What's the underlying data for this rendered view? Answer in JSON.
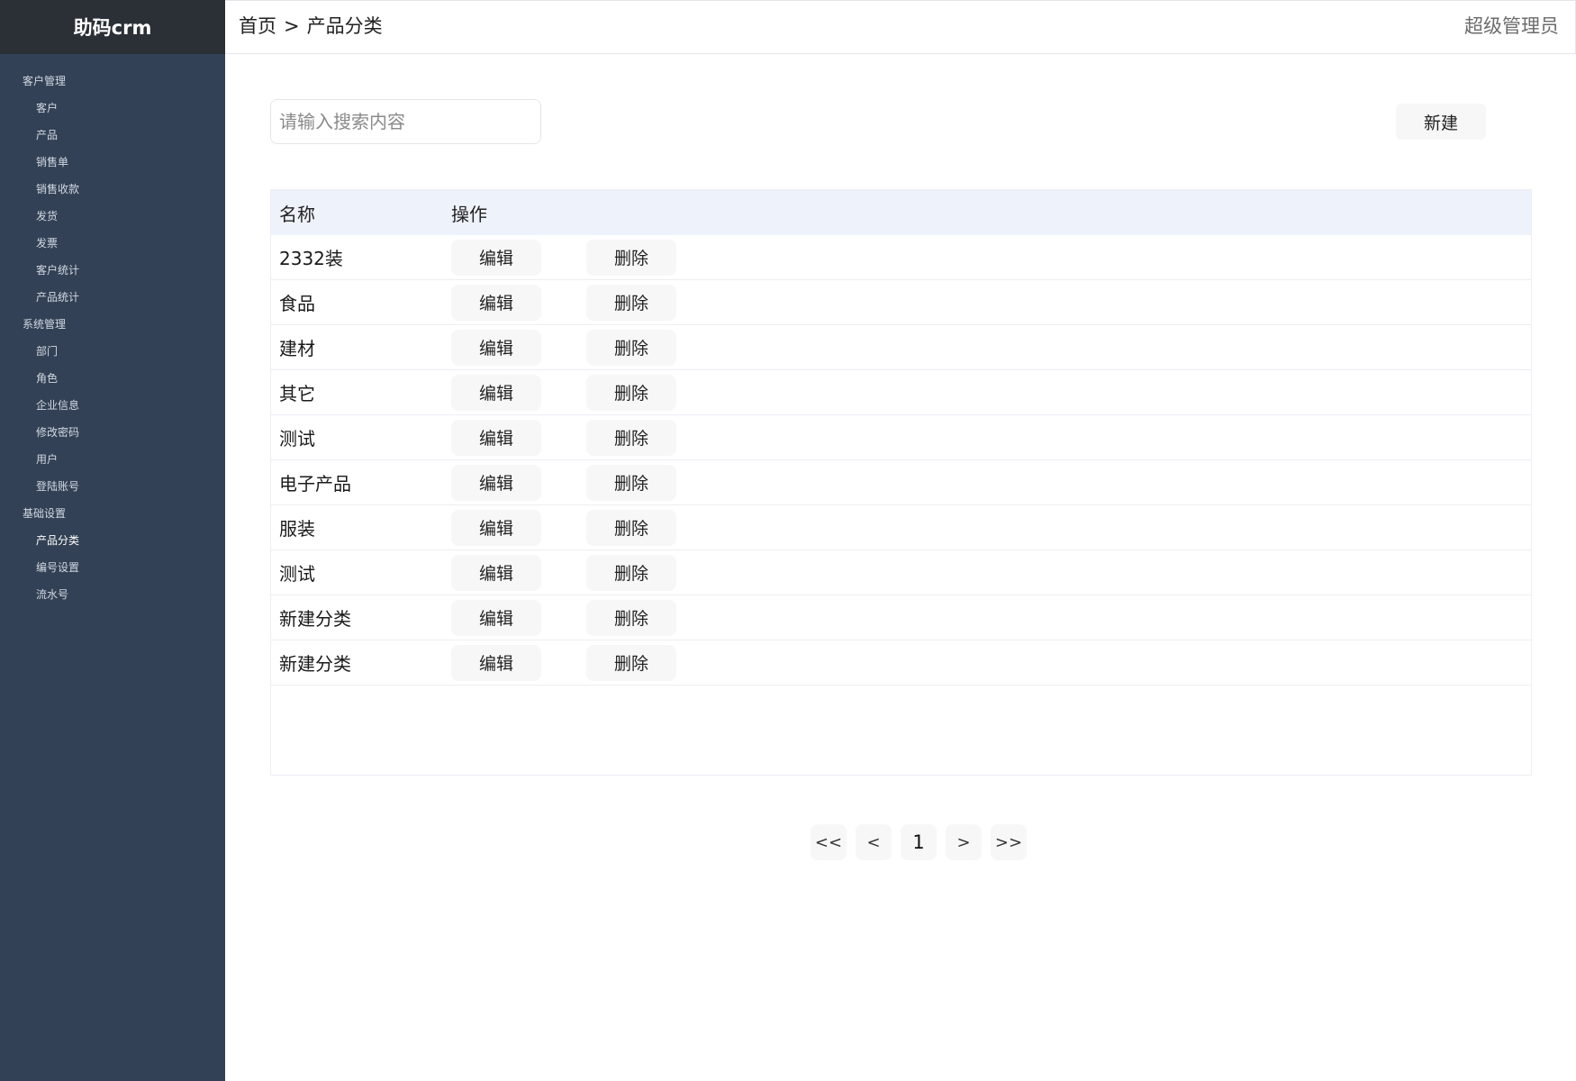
{
  "app": {
    "brand": "助码crm"
  },
  "sidebar": {
    "groups": [
      {
        "label": "客户管理",
        "items": [
          "客户",
          "产品",
          "销售单",
          "销售收款",
          "发货",
          "发票",
          "客户统计",
          "产品统计"
        ]
      },
      {
        "label": "系统管理",
        "items": [
          "部门",
          "角色",
          "企业信息",
          "修改密码",
          "用户",
          "登陆账号"
        ]
      },
      {
        "label": "基础设置",
        "items": [
          "产品分类",
          "编号设置",
          "流水号"
        ]
      }
    ],
    "active_item": "产品分类"
  },
  "header": {
    "breadcrumb": {
      "home": "首页",
      "separator": ">",
      "current": "产品分类"
    },
    "user": "超级管理员"
  },
  "toolbar": {
    "search_placeholder": "请输入搜索内容",
    "search_value": "",
    "new_label": "新建"
  },
  "table": {
    "columns": {
      "name": "名称",
      "ops": "操作"
    },
    "edit_label": "编辑",
    "delete_label": "删除",
    "rows": [
      "2332装",
      "食品",
      "建材",
      "其它",
      "测试",
      "电子产品",
      "服装",
      "测试",
      "新建分类",
      "新建分类"
    ]
  },
  "pagination": {
    "first": "<<",
    "prev": "<",
    "current": "1",
    "next": ">",
    "last": ">>"
  },
  "colors": {
    "sidebar_bg": "#324155",
    "brand_bg": "#2b2f36",
    "table_header_bg": "#eef2fa",
    "button_bg": "#f7f7f7"
  }
}
